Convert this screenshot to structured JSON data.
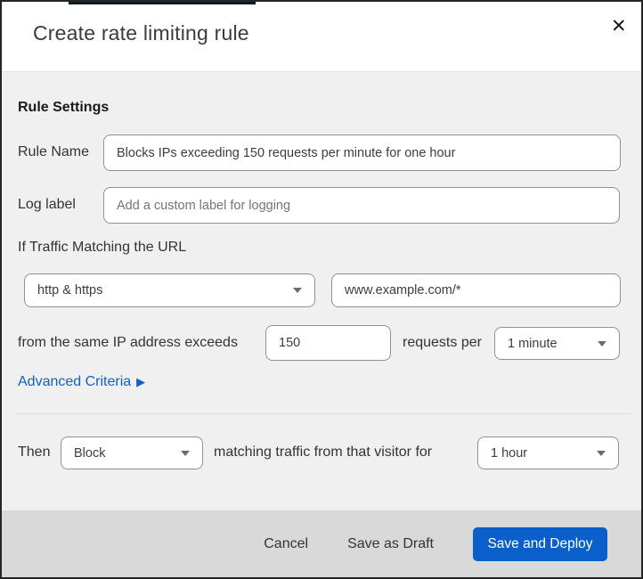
{
  "modal": {
    "title": "Create rate limiting rule"
  },
  "icons": {
    "close": "✕",
    "expand_arrow": "▶"
  },
  "colors": {
    "primary_button": "#0b5fcb",
    "link_blue": "#0f62c9",
    "body_bg": "#f0f0f0",
    "footer_bg": "#d9d9d9",
    "top_strip": "#0c1b2a"
  },
  "form": {
    "section_heading": "Rule Settings",
    "rule_name": {
      "label": "Rule Name",
      "value": "Blocks IPs exceeding 150 requests per minute for one hour"
    },
    "log_label": {
      "label": "Log label",
      "placeholder": "Add a custom label for logging"
    },
    "traffic_match": {
      "heading": "If Traffic Matching the URL",
      "scheme_selected": "http & https",
      "url_value": "www.example.com/*"
    },
    "threshold": {
      "prefix": "from the same IP address exceeds",
      "value": "150",
      "middle": "requests per",
      "period_selected": "1 minute"
    },
    "advanced_criteria": {
      "label": "Advanced Criteria"
    },
    "action": {
      "prefix": "Then",
      "action_selected": "Block",
      "middle": "matching traffic from that visitor for",
      "duration_selected": "1 hour"
    }
  },
  "footer": {
    "cancel_label": "Cancel",
    "save_draft_label": "Save as Draft",
    "save_deploy_label": "Save and Deploy"
  }
}
